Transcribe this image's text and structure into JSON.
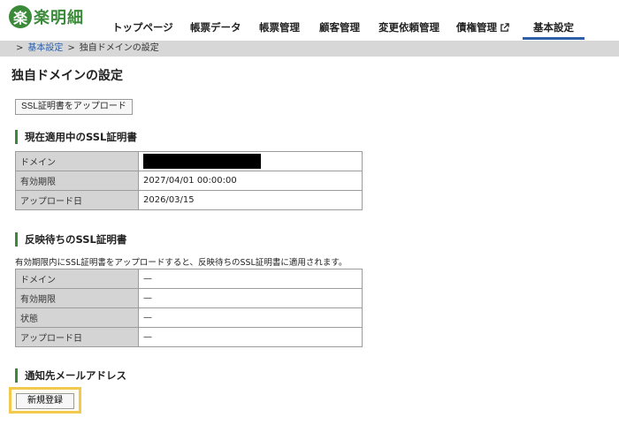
{
  "logo": {
    "mark": "楽",
    "text": "楽明細"
  },
  "nav": [
    {
      "label": "トップページ"
    },
    {
      "label": "帳票データ"
    },
    {
      "label": "帳票管理"
    },
    {
      "label": "顧客管理"
    },
    {
      "label": "変更依頼管理"
    },
    {
      "label": "債権管理"
    },
    {
      "label": "基本設定"
    }
  ],
  "breadcrumb": {
    "root_sep": ">",
    "parent": "基本設定",
    "sep": ">",
    "current": "独自ドメインの設定"
  },
  "page_title": "独自ドメインの設定",
  "upload_button": "SSL証明書をアップロード",
  "current_cert": {
    "heading": "現在適用中のSSL証明書",
    "rows": [
      {
        "label": "ドメイン",
        "value": ""
      },
      {
        "label": "有効期限",
        "value": "2027/04/01 00:00:00"
      },
      {
        "label": "アップロード日",
        "value": "2026/03/15"
      }
    ]
  },
  "pending_cert": {
    "heading": "反映待ちのSSL証明書",
    "note": "有効期限内にSSL証明書をアップロードすると、反映待ちのSSL証明書に適用されます。",
    "rows": [
      {
        "label": "ドメイン",
        "value": "—"
      },
      {
        "label": "有効期限",
        "value": "—"
      },
      {
        "label": "状態",
        "value": "—"
      },
      {
        "label": "アップロード日",
        "value": "—"
      }
    ]
  },
  "notify": {
    "heading": "通知先メールアドレス",
    "register_button": "新規登録"
  },
  "colors": {
    "brand_green": "#3a8a3a",
    "nav_active": "#2d5fa8",
    "highlight": "#f2c94c"
  }
}
